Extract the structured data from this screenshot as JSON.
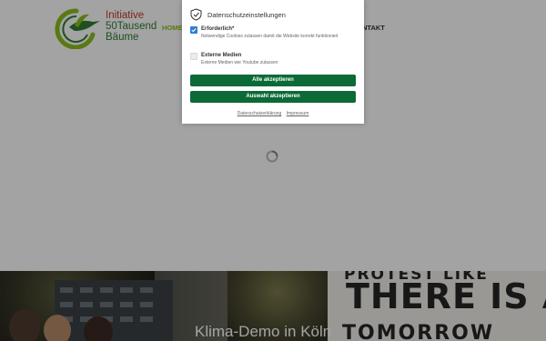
{
  "site": {
    "brand_line1": "Initiative",
    "brand_line2": "50Tausend",
    "brand_line3": "Bäume",
    "nav_home": "HOME",
    "nav_kontakt": "NTAKT",
    "logo_icon": "hummingbird-circle-logo-icon",
    "brand_colors": {
      "red": "#c0392b",
      "green": "#2f7d32",
      "nav_active": "#8cbf1f"
    }
  },
  "hero": {
    "title": "Klima-Demo in Köln",
    "sign_line1": "PROTEST LIKE",
    "sign_line2": "THERE IS A",
    "sign_line3": "TOMORROW"
  },
  "cookie_modal": {
    "title": "Datenschutzeinstellungen",
    "icon": "shield-check-icon",
    "options": [
      {
        "label": "Erforderlich*",
        "description": "Notwendige Cookies zulassen damit die Website korrekt funktioniert",
        "checked": true
      },
      {
        "label": "Externe Medien",
        "description": "Externe Medien wie Youtube zulassen",
        "checked": false
      }
    ],
    "accept_all_label": "Alle akzeptieren",
    "accept_selection_label": "Auswahl akzeptieren",
    "privacy_link": "Datenschutzerklärung",
    "imprint_link": "Impressum",
    "button_color": "#0b6a36",
    "checkbox_color": "#2f7dd7"
  }
}
